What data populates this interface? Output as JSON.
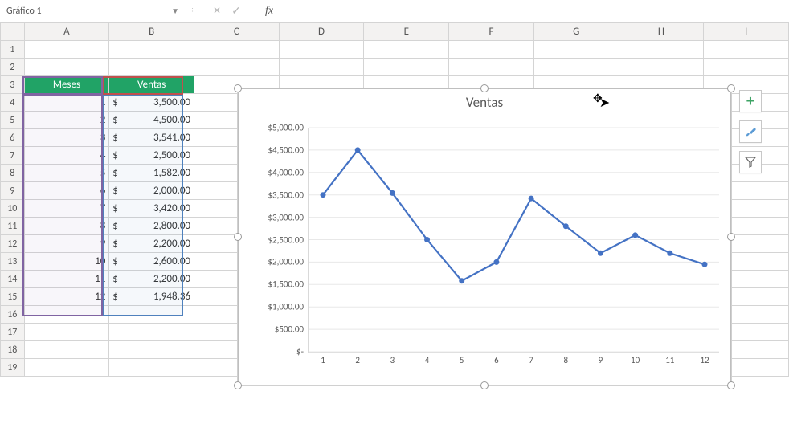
{
  "formula_bar": {
    "name_box": "Gráfico 1",
    "cancel": "✕",
    "accept": "✓",
    "fx": "fx"
  },
  "columns": [
    "A",
    "B",
    "C",
    "D",
    "E",
    "F",
    "G",
    "H",
    "I"
  ],
  "rows": [
    "1",
    "2",
    "3",
    "4",
    "5",
    "6",
    "7",
    "8",
    "9",
    "10",
    "11",
    "12",
    "13",
    "14",
    "15",
    "16",
    "17",
    "18",
    "19"
  ],
  "headers": {
    "meses": "Meses",
    "ventas": "Ventas"
  },
  "months": [
    "1",
    "2",
    "3",
    "4",
    "5",
    "6",
    "7",
    "8",
    "9",
    "10",
    "11",
    "12"
  ],
  "sales_display": [
    "3,500.00",
    "4,500.00",
    "3,541.00",
    "2,500.00",
    "1,582.00",
    "2,000.00",
    "3,420.00",
    "2,800.00",
    "2,200.00",
    "2,600.00",
    "2,200.00",
    "1,948.36"
  ],
  "currency": "$",
  "chart": {
    "title": "Ventas",
    "yticks": [
      "$5,000.00",
      "$4,500.00",
      "$4,000.00",
      "$3,500.00",
      "$3,000.00",
      "$2,500.00",
      "$2,000.00",
      "$1,500.00",
      "$1,000.00",
      "$500.00",
      "$-"
    ],
    "xticks": [
      "1",
      "2",
      "3",
      "4",
      "5",
      "6",
      "7",
      "8",
      "9",
      "10",
      "11",
      "12"
    ]
  },
  "side_buttons": {
    "plus": "+",
    "brush": "✎",
    "filter": "⑂"
  },
  "chart_data": {
    "type": "line",
    "title": "Ventas",
    "xlabel": "",
    "ylabel": "",
    "ylim": [
      0,
      5000
    ],
    "categories": [
      1,
      2,
      3,
      4,
      5,
      6,
      7,
      8,
      9,
      10,
      11,
      12
    ],
    "values": [
      3500.0,
      4500.0,
      3541.0,
      2500.0,
      1582.0,
      2000.0,
      3420.0,
      2800.0,
      2200.0,
      2600.0,
      2200.0,
      1948.36
    ]
  }
}
